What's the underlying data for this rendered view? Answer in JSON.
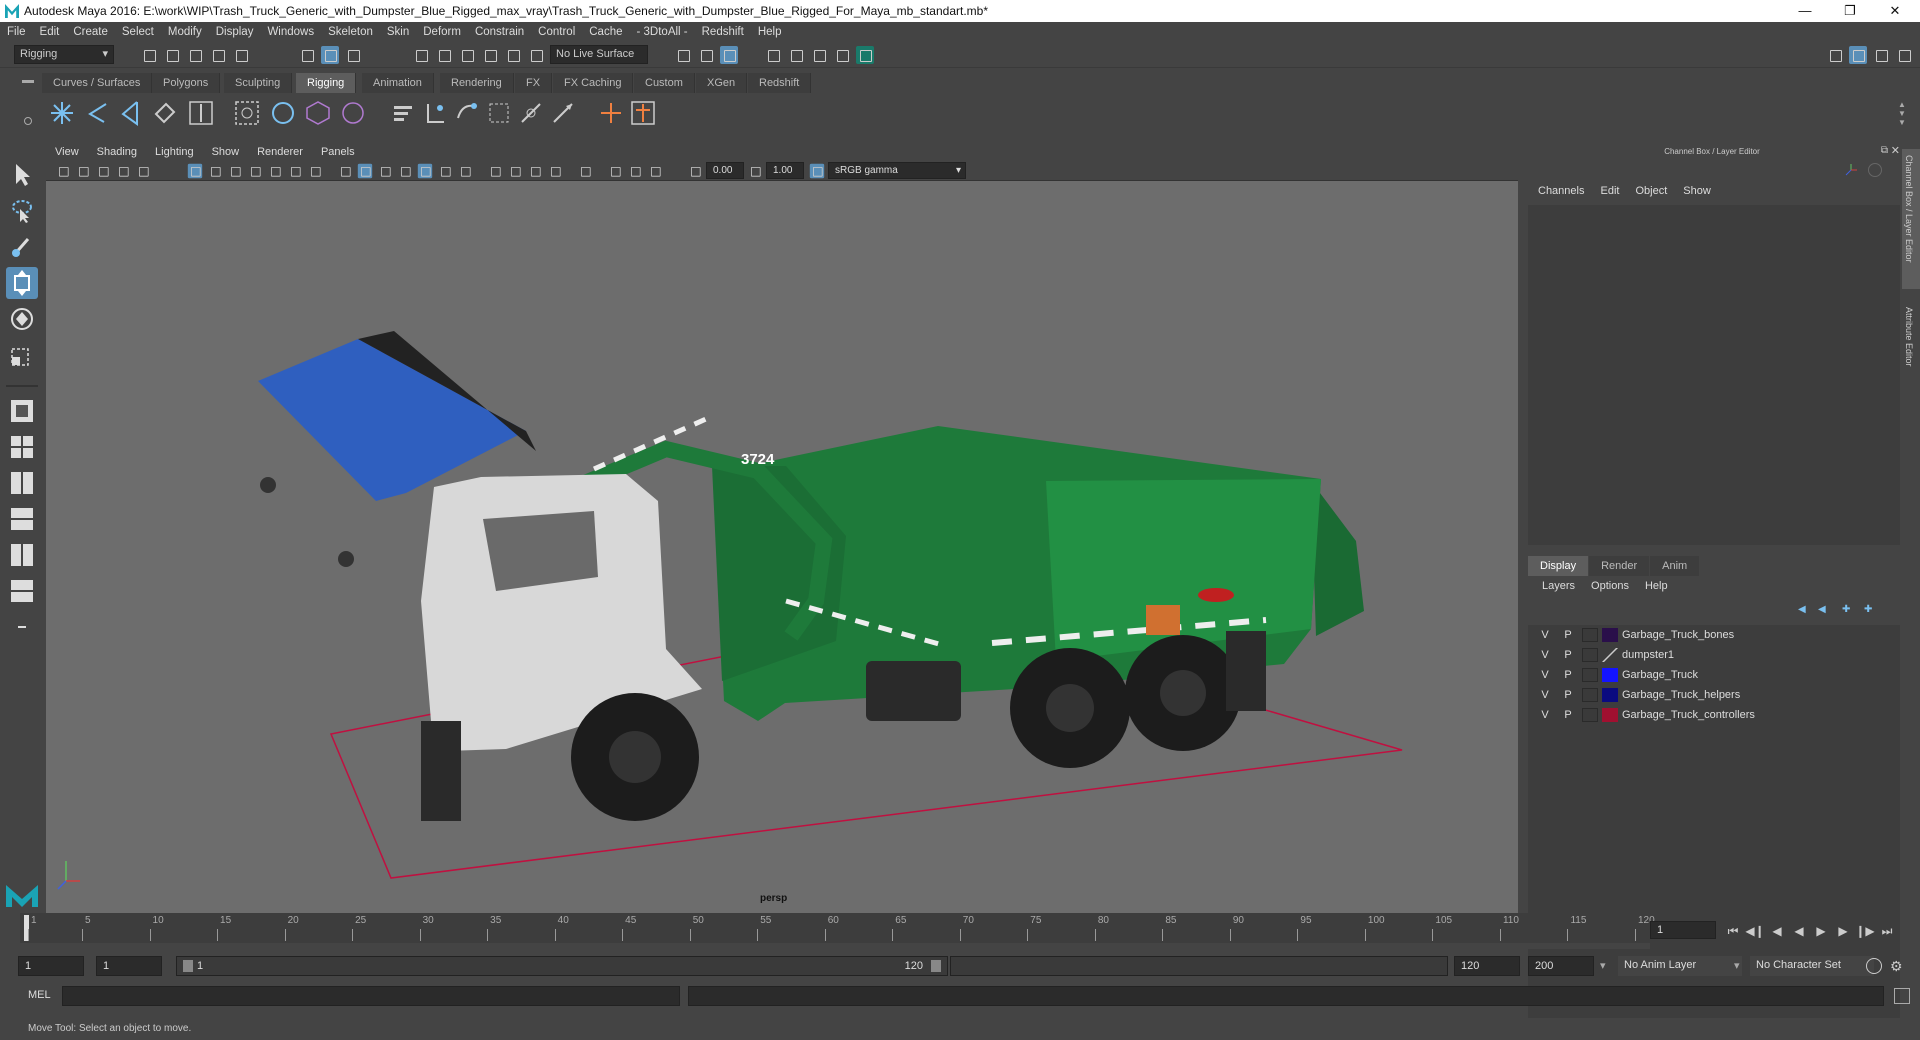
{
  "window": {
    "title": "Autodesk Maya 2016: E:\\work\\WIP\\Trash_Truck_Generic_with_Dumpster_Blue_Rigged_max_vray\\Trash_Truck_Generic_with_Dumpster_Blue_Rigged_For_Maya_mb_standart.mb*"
  },
  "menubar": [
    "File",
    "Edit",
    "Create",
    "Select",
    "Modify",
    "Display",
    "Windows",
    "Skeleton",
    "Skin",
    "Deform",
    "Constrain",
    "Control",
    "Cache",
    "- 3DtoAll -",
    "Redshift",
    "Help"
  ],
  "statusline": {
    "mode": "Rigging",
    "live_surface": "No Live Surface"
  },
  "shelf_tabs": [
    "Curves / Surfaces",
    "Polygons",
    "Sculpting",
    "Rigging",
    "Animation",
    "Rendering",
    "FX",
    "FX Caching",
    "Custom",
    "XGen",
    "Redshift"
  ],
  "shelf_active": "Rigging",
  "viewport": {
    "menu": [
      "View",
      "Shading",
      "Lighting",
      "Show",
      "Renderer",
      "Panels"
    ],
    "exposure": "0.00",
    "gamma": "1.00",
    "color_space": "sRGB gamma",
    "camera_label": "persp",
    "truck_number": "3724"
  },
  "channel_box": {
    "header": "Channel Box / Layer Editor",
    "menu": [
      "Channels",
      "Edit",
      "Object",
      "Show"
    ]
  },
  "layer_editor": {
    "tabs": [
      "Display",
      "Render",
      "Anim"
    ],
    "active_tab": "Display",
    "menu": [
      "Layers",
      "Options",
      "Help"
    ],
    "layers": [
      {
        "v": "V",
        "p": "P",
        "color": "#2a0f4a",
        "name": "Garbage_Truck_bones"
      },
      {
        "v": "V",
        "p": "P",
        "color": "none",
        "name": "dumpster1"
      },
      {
        "v": "V",
        "p": "P",
        "color": "#1414ff",
        "name": "Garbage_Truck"
      },
      {
        "v": "V",
        "p": "P",
        "color": "#0a0a80",
        "name": "Garbage_Truck_helpers"
      },
      {
        "v": "V",
        "p": "P",
        "color": "#a01030",
        "name": "Garbage_Truck_controllers"
      }
    ]
  },
  "side_labels": [
    "Channel Box / Layer Editor",
    "Attribute Editor"
  ],
  "timeline": {
    "ticks": [
      "1",
      "5",
      "10",
      "15",
      "20",
      "25",
      "30",
      "35",
      "40",
      "45",
      "50",
      "55",
      "60",
      "65",
      "70",
      "75",
      "80",
      "85",
      "90",
      "95",
      "100",
      "105",
      "110",
      "115",
      "120"
    ],
    "current_frame": "1"
  },
  "range": {
    "start": "1",
    "start2": "1",
    "slider_start": "1",
    "slider_end": "120",
    "end": "120",
    "end2": "200",
    "anim_layer": "No Anim Layer",
    "char_set": "No Character Set"
  },
  "command_line": {
    "label": "MEL"
  },
  "help_line": "Move Tool: Select an object to move."
}
